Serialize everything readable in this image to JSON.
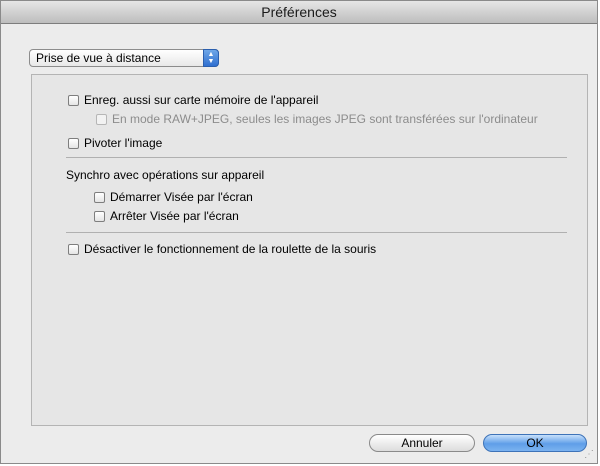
{
  "window": {
    "title": "Préférences"
  },
  "category": {
    "selected": "Prise de vue à distance"
  },
  "options": {
    "save_to_card": "Enreg. aussi sur carte mémoire de l'appareil",
    "raw_jpeg_note": "En mode RAW+JPEG, seules les images JPEG sont transférées sur l'ordinateur",
    "rotate_image": "Pivoter l'image",
    "sync_heading": "Synchro avec opérations sur appareil",
    "start_liveview": "Démarrer Visée par l'écran",
    "stop_liveview": "Arrêter Visée par l'écran",
    "disable_wheel": "Désactiver le fonctionnement de la roulette de la souris"
  },
  "checkbox_states": {
    "save_to_card": false,
    "raw_jpeg_note": false,
    "rotate_image": false,
    "start_liveview": false,
    "stop_liveview": false,
    "disable_wheel": false
  },
  "buttons": {
    "cancel": "Annuler",
    "ok": "OK"
  },
  "colors": {
    "default_button": "#5f9ee8",
    "panel": "#e6e6e6",
    "window": "#ececec"
  }
}
